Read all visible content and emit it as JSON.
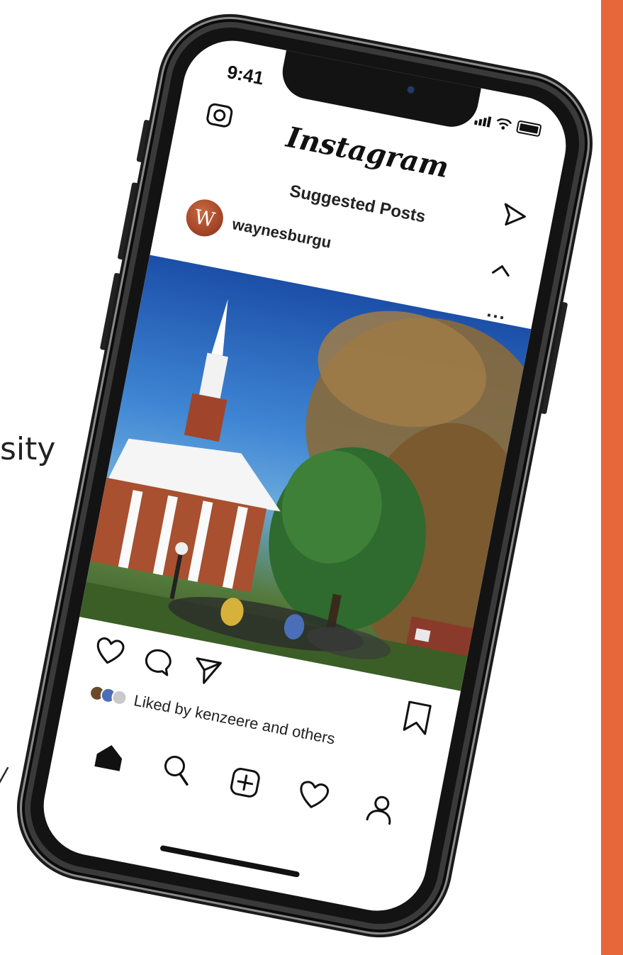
{
  "background": {
    "partial_text_1": "sity",
    "partial_text_2": "/",
    "accent_color": "#e8673a"
  },
  "status_bar": {
    "time": "9:41",
    "icons": [
      "signal-icon",
      "wifi-icon",
      "battery-icon"
    ]
  },
  "header": {
    "app_name": "Instagram",
    "left_icon": "camera-icon",
    "right_icon": "direct-message-icon"
  },
  "feed": {
    "section_title": "Suggested Posts"
  },
  "post": {
    "avatar_letter": "W",
    "username": "waynesburgu",
    "collapse_icon": "chevron-up-icon",
    "more_label": "...",
    "image_subject": "campus-chapel-photo",
    "liked_by": "Liked by kenzeere and others"
  },
  "post_actions": [
    "heart-icon",
    "comment-icon",
    "share-icon",
    "bookmark-icon"
  ],
  "tab_bar": [
    "home-icon",
    "search-icon",
    "new-post-icon",
    "activity-heart-icon",
    "profile-icon"
  ]
}
